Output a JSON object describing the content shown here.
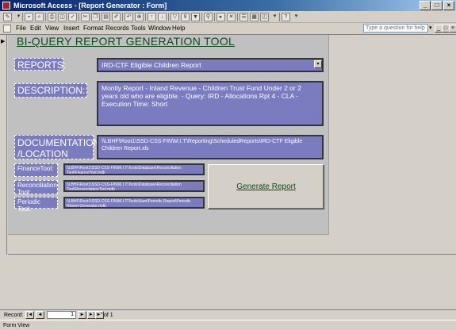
{
  "window": {
    "title": "Microsoft Access - [Report Generator : Form]",
    "controls": [
      "_",
      "□",
      "×"
    ]
  },
  "toolbar": {
    "icons": [
      "view-icon",
      "save-icon",
      "search-icon",
      "print-icon",
      "print-preview-icon",
      "spelling-icon",
      "cut-icon",
      "copy-icon",
      "paste-icon",
      "format-painter-icon",
      "undo-icon",
      "hyperlink-icon",
      "sort-ascending-icon",
      "sort-descending-icon",
      "filter-by-selection-icon",
      "filter-by-form-icon",
      "apply-filter-icon",
      "find-icon",
      "new-record-icon",
      "delete-record-icon",
      "properties-icon",
      "database-window-icon",
      "new-object-icon",
      "help-icon"
    ]
  },
  "menubar": {
    "items": [
      "File",
      "Edit",
      "View",
      "Insert",
      "Format",
      "Records",
      "Tools",
      "Window",
      "Help"
    ],
    "help_placeholder": "Type a question for help",
    "mdi_controls": [
      "_",
      "□",
      "×"
    ]
  },
  "form": {
    "title": "BI-QUERY REPORT GENERATION TOOL",
    "reports_label": "REPORTS:",
    "reports_value": "IRD-CTF Eligible Children Report",
    "description_label": "DESCRIPTION:",
    "description_value": "Montly Report - Inland Revenue - Children Trust Fund Under 2 or 2 years old who are eligible. - Query: IRD - Allocations Rpt 4 - CLA - Execution Time: Short",
    "documentation_label": "DOCUMENTATION /LOCATION",
    "documentation_value": "\\\\LBHF\\Root1\\SSD-CSS-FIN\\M.I.T\\Reporting\\ScheduledReports\\IRD-CTF Eligible Children Report.xls",
    "finance_tool_label": "FinanceTool:",
    "finance_tool_value": "\\\\LBHF\\Root1\\SSD-CSS-FIN\\M.I.T\\Tools\\Database\\Reconciliation Tool\\FinanceTool.mdb",
    "reconciliation_tool_label": "Reconciliation Tool:",
    "reconciliation_tool_value": "\\\\LBHF\\Root1\\SSD-CSS-FIN\\M.I.T\\Tools\\Database\\Reconciliation Tool\\ReconcilationTool.mdb",
    "periodic_tool_label": "Periodic Tool:",
    "periodic_tool_value": "\\\\LBHF\\Root1\\SSD-CSS-FIN\\M.I.T\\Tools\\Sam\\Periodic Report\\Periodic Report Generator.mdb",
    "generate_button": "Generate Report"
  },
  "navigation": {
    "record_label": "Record:",
    "current_record": "1",
    "of_label": "of  1",
    "buttons": [
      "|◄",
      "◄",
      "►",
      "►|",
      "►*"
    ]
  },
  "status": {
    "text": "Form View"
  }
}
